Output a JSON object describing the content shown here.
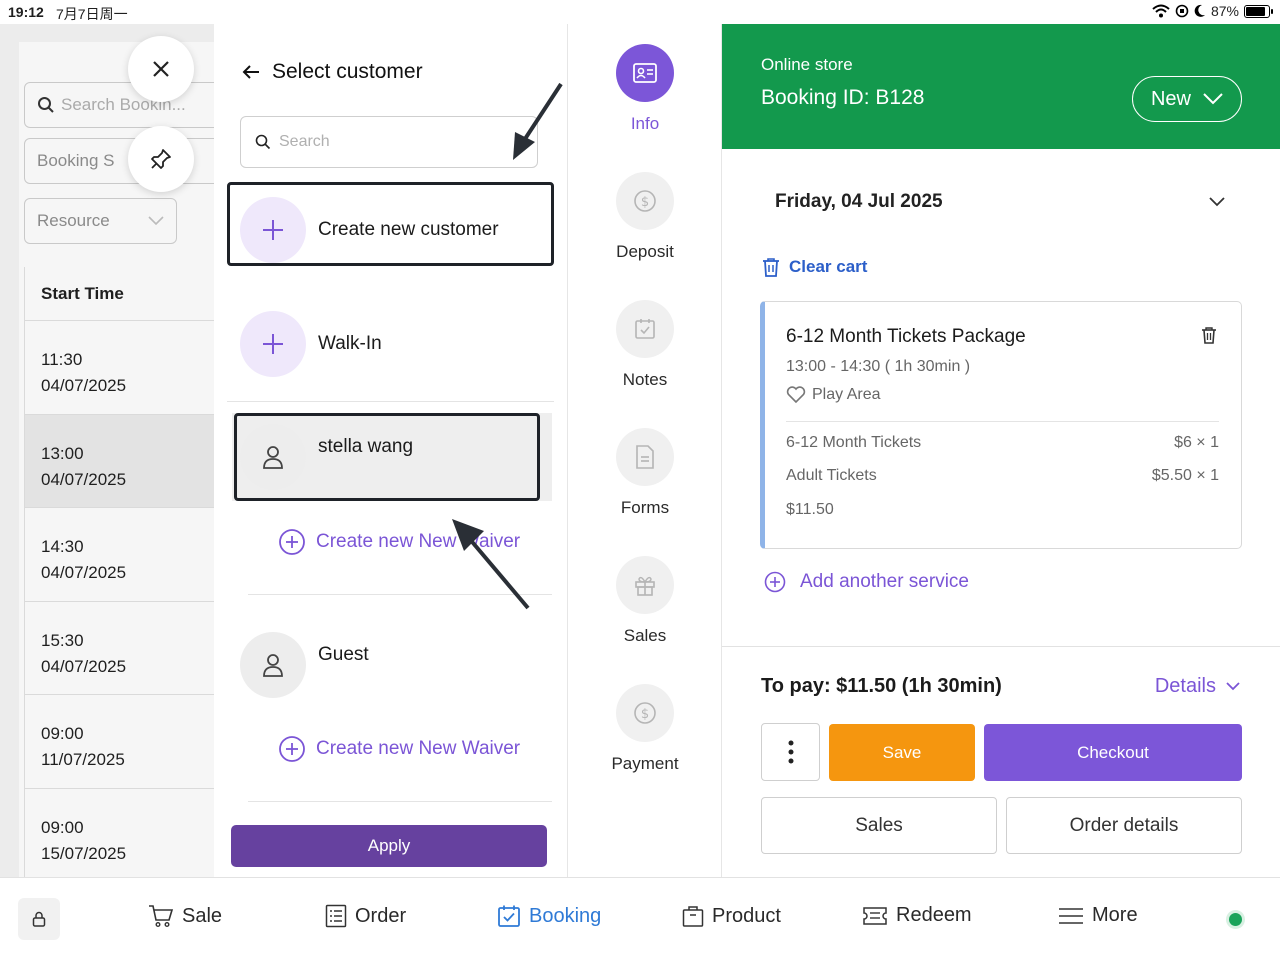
{
  "status_bar": {
    "time": "19:12",
    "date": "7月7日周一",
    "battery": "87%"
  },
  "left_list": {
    "search_placeholder": "Search Bookin...",
    "booking_filter": "Booking S",
    "resource_filter": "Resource",
    "column_header": "Start Time",
    "rows": [
      {
        "time": "11:30",
        "date": "04/07/2025"
      },
      {
        "time": "13:00",
        "date": "04/07/2025"
      },
      {
        "time": "14:30",
        "date": "04/07/2025"
      },
      {
        "time": "15:30",
        "date": "04/07/2025"
      },
      {
        "time": "09:00",
        "date": "11/07/2025"
      },
      {
        "time": "09:00",
        "date": "15/07/2025"
      }
    ]
  },
  "customer_panel": {
    "title": "Select customer",
    "search_placeholder": "Search",
    "create_new_customer": "Create new customer",
    "walk_in": "Walk-In",
    "customers": [
      {
        "name": "stella wang",
        "waiver_link": "Create new New Waiver"
      },
      {
        "name": "Guest",
        "waiver_link": "Create new New Waiver"
      }
    ],
    "apply_label": "Apply"
  },
  "rail": {
    "items": [
      {
        "label": "Info",
        "icon": "id-card-icon",
        "active": true
      },
      {
        "label": "Deposit",
        "icon": "dollar-circle-icon"
      },
      {
        "label": "Notes",
        "icon": "calendar-check-icon"
      },
      {
        "label": "Forms",
        "icon": "document-icon"
      },
      {
        "label": "Sales",
        "icon": "gift-icon"
      },
      {
        "label": "Payment",
        "icon": "dollar-circle-icon"
      }
    ]
  },
  "booking": {
    "store": "Online store",
    "booking_id": "Booking ID: B128",
    "status": "New",
    "date": "Friday, 04 Jul 2025",
    "clear_cart": "Clear cart",
    "service": {
      "title": "6-12 Month Tickets Package",
      "time": "13:00 - 14:30 ( 1h 30min )",
      "area": "Play Area",
      "lines": [
        {
          "name": "6-12 Month Tickets",
          "price": "$6 × 1"
        },
        {
          "name": "Adult Tickets",
          "price": "$5.50 × 1"
        }
      ],
      "subtotal": "$11.50"
    },
    "add_service": "Add another service",
    "to_pay": "To pay: $11.50 (1h 30min)",
    "details": "Details",
    "save": "Save",
    "checkout": "Checkout",
    "sales": "Sales",
    "order_details": "Order details"
  },
  "bottom_nav": {
    "items": [
      {
        "label": "Sale",
        "icon": "cart-icon"
      },
      {
        "label": "Order",
        "icon": "list-icon"
      },
      {
        "label": "Booking",
        "icon": "calendar-check-icon",
        "active": true
      },
      {
        "label": "Product",
        "icon": "bag-icon"
      },
      {
        "label": "Redeem",
        "icon": "ticket-icon"
      },
      {
        "label": "More",
        "icon": "menu-icon"
      }
    ]
  },
  "colors": {
    "brand_green": "#13994d",
    "accent_purple": "#7c56d8",
    "apply_purple": "#66419f",
    "save_orange": "#f5960f",
    "nav_active_blue": "#2f7ad6"
  }
}
